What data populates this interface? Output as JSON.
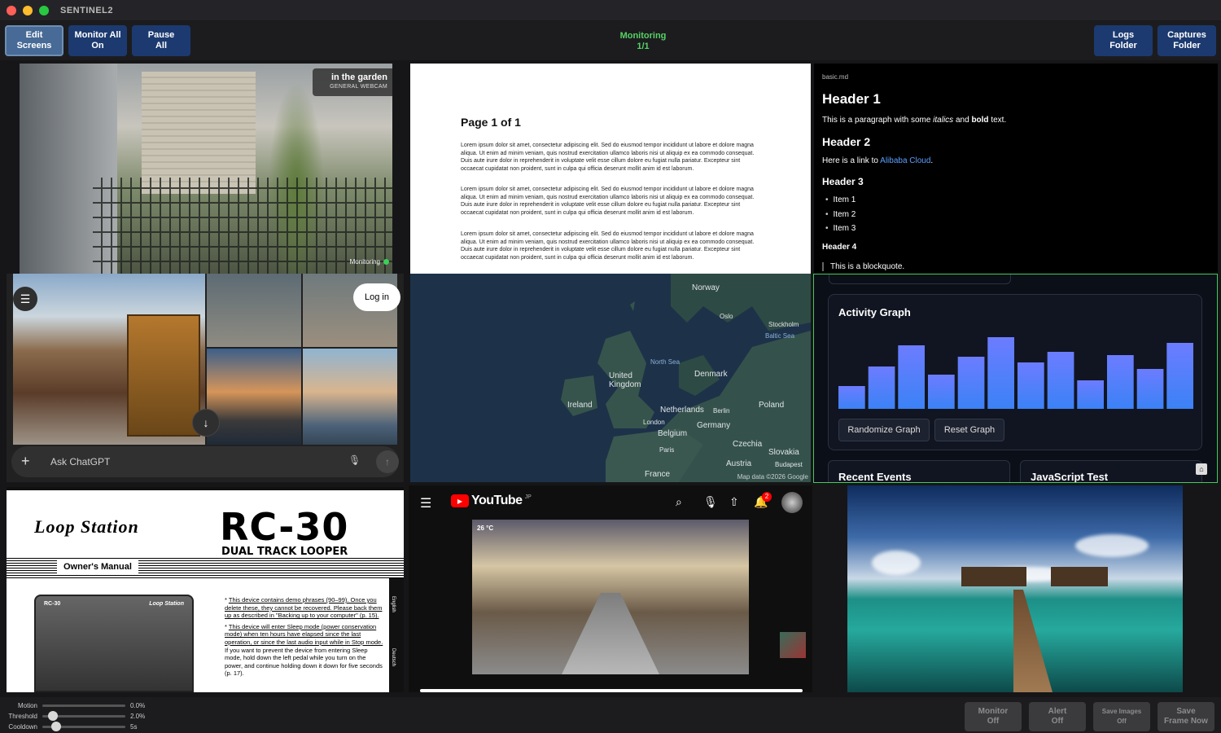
{
  "app": {
    "title": "SENTINEL2"
  },
  "toolbar": {
    "edit_screens": "Edit\nScreens",
    "monitor_all_on": "Monitor All\nOn",
    "pause_all": "Pause\nAll",
    "status_line1": "Monitoring",
    "status_line2": "1/1",
    "logs_folder": "Logs\nFolder",
    "captures_folder": "Captures\nFolder"
  },
  "webcam": {
    "title": "in the garden",
    "subtitle": "GENERAL WEBCAM",
    "indicator": "Monitoring"
  },
  "pdf": {
    "title": "Page 1 of 1",
    "paragraphs": [
      "Lorem ipsum dolor sit amet, consectetur adipiscing elit. Sed do eiusmod tempor incididunt ut labore et dolore magna aliqua. Ut enim ad minim veniam, quis nostrud exercitation ullamco laboris nisi ut aliquip ex ea commodo consequat. Duis aute irure dolor in reprehenderit in voluptate velit esse cillum dolore eu fugiat nulla pariatur. Excepteur sint occaecat cupidatat non proident, sunt in culpa qui officia deserunt mollit anim id est laborum.",
      "Lorem ipsum dolor sit amet, consectetur adipiscing elit. Sed do eiusmod tempor incididunt ut labore et dolore magna aliqua. Ut enim ad minim veniam, quis nostrud exercitation ullamco laboris nisi ut aliquip ex ea commodo consequat. Duis aute irure dolor in reprehenderit in voluptate velit esse cillum dolore eu fugiat nulla pariatur. Excepteur sint occaecat cupidatat non proident, sunt in culpa qui officia deserunt mollit anim id est laborum.",
      "Lorem ipsum dolor sit amet, consectetur adipiscing elit. Sed do eiusmod tempor incididunt ut labore et dolore magna aliqua. Ut enim ad minim veniam, quis nostrud exercitation ullamco laboris nisi ut aliquip ex ea commodo consequat. Duis aute irure dolor in reprehenderit in voluptate velit esse cillum dolore eu fugiat nulla pariatur. Excepteur sint occaecat cupidatat non proident, sunt in culpa qui officia deserunt mollit anim id est laborum."
    ]
  },
  "markdown": {
    "filename": "basic.md",
    "h1": "Header 1",
    "p1_a": "This is a paragraph with some ",
    "p1_italic": "italics",
    "p1_b": " and ",
    "p1_bold": "bold",
    "p1_c": " text.",
    "h2": "Header 2",
    "p2_a": "Here is a link to ",
    "p2_link": "Alibaba Cloud",
    "p2_b": ".",
    "h3": "Header 3",
    "items": [
      "Item 1",
      "Item 2",
      "Item 3"
    ],
    "h4": "Header 4",
    "blockquote": "This is a blockquote."
  },
  "chatgpt": {
    "login": "Log in",
    "placeholder": "Ask ChatGPT"
  },
  "map": {
    "labels": {
      "norway": "Norway",
      "oslo": "Oslo",
      "stockholm": "Stockholm",
      "baltic": "Baltic Sea",
      "north_sea": "North Sea",
      "uk": "United\nKingdom",
      "denmark": "Denmark",
      "ireland": "Ireland",
      "netherlands": "Netherlands",
      "berlin": "Berlin",
      "poland": "Poland",
      "london": "London",
      "germany": "Germany",
      "belgium": "Belgium",
      "czechia": "Czechia",
      "paris": "Paris",
      "slovakia": "Slovakia",
      "austria": "Austria",
      "budapest": "Budapest",
      "france": "France"
    },
    "attribution": "Map data ©2026 Google"
  },
  "activity": {
    "title": "Activity Graph",
    "randomize": "Randomize Graph",
    "reset": "Reset Graph",
    "recent_events": "Recent Events",
    "js_test": "JavaScript Test"
  },
  "chart_data": {
    "type": "bar",
    "title": "Activity Graph",
    "values": [
      28,
      52,
      78,
      42,
      64,
      88,
      57,
      70,
      35,
      66,
      49,
      81
    ],
    "ylim": [
      0,
      100
    ],
    "colors": {
      "top": "#6c7cff",
      "bottom": "#3b82f6"
    }
  },
  "manual": {
    "brand": "Loop Station",
    "model": "RC-30",
    "subtitle": "DUAL TRACK LOOPER",
    "owners_manual": "Owner's Manual",
    "device_model": "RC-30",
    "device_brand": "Loop Station",
    "note1": "This device contains demo phrases (90–99). Once you delete these, they cannot be recovered. Please back them up as described in \"Backing up to your computer\" (p. 15).",
    "note2_u": "This device will enter Sleep mode (power conservation mode) when ten hours have elapsed since the last operation, or since the last audio input while in Stop mode.",
    "note2": "If you want to prevent the device from entering Sleep mode, hold down the left pedal while you turn on the power, and continue holding down it down for five seconds (p. 17).",
    "lang1": "English",
    "lang2": "Deutsch"
  },
  "youtube": {
    "logo": "YouTube",
    "region": "JP",
    "notifications": "2",
    "weather": "26 °C"
  },
  "bottom": {
    "motion_label": "Motion",
    "motion_value": "0.0%",
    "motion_level": 0.0,
    "threshold_label": "Threshold",
    "threshold_value": "2.0%",
    "threshold_level": 0.08,
    "cooldown_label": "Cooldown",
    "cooldown_value": "5s",
    "cooldown_level": 0.12,
    "monitor_off": "Monitor\nOff",
    "alert_off": "Alert\nOff",
    "save_images_off": "Save Images\nOff",
    "save_frame_now": "Save\nFrame Now"
  },
  "colors": {
    "accent": "#1c3a70",
    "status_green": "#56d364",
    "active_border": "#47c85e"
  }
}
